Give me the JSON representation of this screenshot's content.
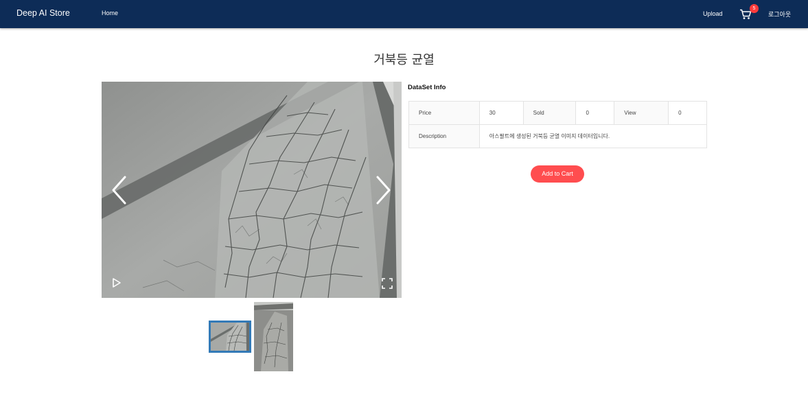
{
  "navbar": {
    "brand": "Deep AI Store",
    "home": "Home",
    "upload": "Upload",
    "cart_count": "5",
    "logout": "로그아웃"
  },
  "product": {
    "title": "거북등 균열"
  },
  "gallery": {
    "main_image": "cracked-asphalt-photo",
    "thumbnails": [
      "cracked-asphalt-thumb-1",
      "cracked-asphalt-thumb-2"
    ]
  },
  "info": {
    "heading": "DataSet Info",
    "price_label": "Price",
    "price_value": "30",
    "sold_label": "Sold",
    "sold_value": "0",
    "view_label": "View",
    "view_value": "0",
    "description_label": "Description",
    "description_value": "아스팔트에 생성된 거북등 균열 이미지 데이터입니다."
  },
  "actions": {
    "add_to_cart": "Add to Cart"
  },
  "colors": {
    "navbar": "#0d2c57",
    "badge": "#ff3b3b",
    "button": "#ff4d4f",
    "thumb_border": "#337ab7"
  }
}
